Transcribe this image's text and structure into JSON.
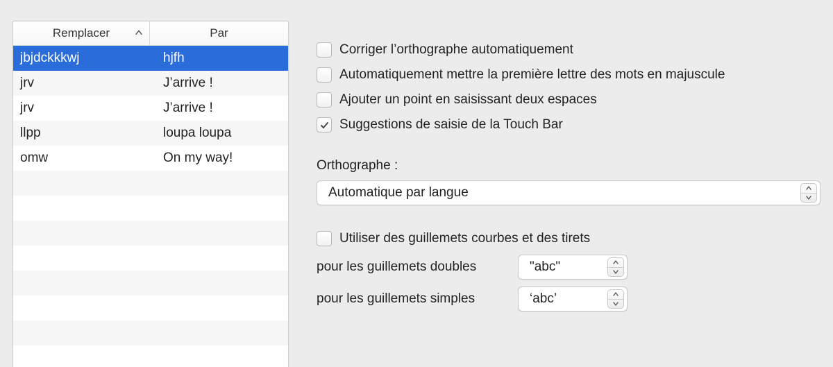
{
  "table": {
    "headers": {
      "replace": "Remplacer",
      "with": "Par"
    },
    "rows": [
      {
        "replace": "jbjdckkkwj",
        "with": "hjfh",
        "selected": true
      },
      {
        "replace": "jrv",
        "with": "J’arrive !",
        "selected": false
      },
      {
        "replace": "jrv",
        "with": "J’arrive !",
        "selected": false
      },
      {
        "replace": "llpp",
        "with": "loupa loupa",
        "selected": false
      },
      {
        "replace": "omw",
        "with": "On my way!",
        "selected": false
      }
    ],
    "empty_rows": 8
  },
  "checks": {
    "auto_spell": {
      "label": "Corriger l’orthographe automatiquement",
      "checked": false
    },
    "auto_cap": {
      "label": "Automatiquement mettre la première lettre des mots en majuscule",
      "checked": false
    },
    "double_space": {
      "label": "Ajouter un point en saisissant deux espaces",
      "checked": false
    },
    "touchbar": {
      "label": "Suggestions de saisie de la Touch Bar",
      "checked": true
    },
    "smart_quotes": {
      "label": "Utiliser des guillemets courbes et des tirets",
      "checked": false
    }
  },
  "spelling": {
    "label": "Orthographe :",
    "value": "Automatique par langue"
  },
  "quotes": {
    "double_label": "pour les guillemets doubles",
    "double_value": "\"abc\"",
    "single_label": "pour les guillemets simples",
    "single_value": "‘abc’"
  }
}
